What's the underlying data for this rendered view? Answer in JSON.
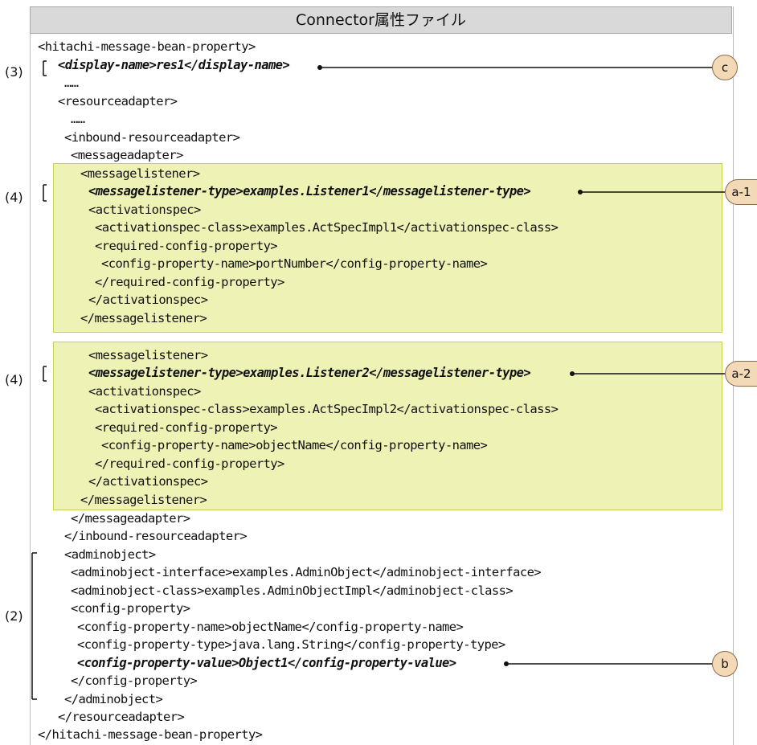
{
  "header": {
    "title": "Connector属性ファイル"
  },
  "labels": {
    "l3": "(3)",
    "l4a": "(4)",
    "l4b": "(4)",
    "l2": "(2)"
  },
  "callouts": {
    "c": "c",
    "a1": "a-1",
    "a2": "a-2",
    "b": "b"
  },
  "code": [
    "<hitachi-message-bean-property>",
    "<display-name>res1</display-name>",
    "……",
    "<resourceadapter>",
    "……",
    "<inbound-resourceadapter>",
    "<messageadapter>",
    "<messagelistener>",
    "<messagelistener-type>examples.Listener1</messagelistener-type>",
    "<activationspec>",
    "<activationspec-class>examples.ActSpecImpl1</activationspec-class>",
    "<required-config-property>",
    "<config-property-name>portNumber</config-property-name>",
    "</required-config-property>",
    "</activationspec>",
    "</messagelistener>",
    "<messagelistener>",
    "<messagelistener-type>examples.Listener2</messagelistener-type>",
    "<activationspec>",
    "<activationspec-class>examples.ActSpecImpl2</activationspec-class>",
    "<required-config-property>",
    "<config-property-name>objectName</config-property-name>",
    "</required-config-property>",
    "</activationspec>",
    "</messagelistener>",
    "</messageadapter>",
    "</inbound-resourceadapter>",
    "<adminobject>",
    "<adminobject-interface>examples.AdminObject</adminobject-interface>",
    "<adminobject-class>examples.AdminObjectImpl</adminobject-class>",
    "<config-property>",
    "<config-property-name>objectName</config-property-name>",
    "<config-property-type>java.lang.String</config-property-type>",
    "<config-property-value>Object1</config-property-value>",
    "</config-property>",
    "</adminobject>",
    "</resourceadapter>",
    "</hitachi-message-bean-property>"
  ]
}
